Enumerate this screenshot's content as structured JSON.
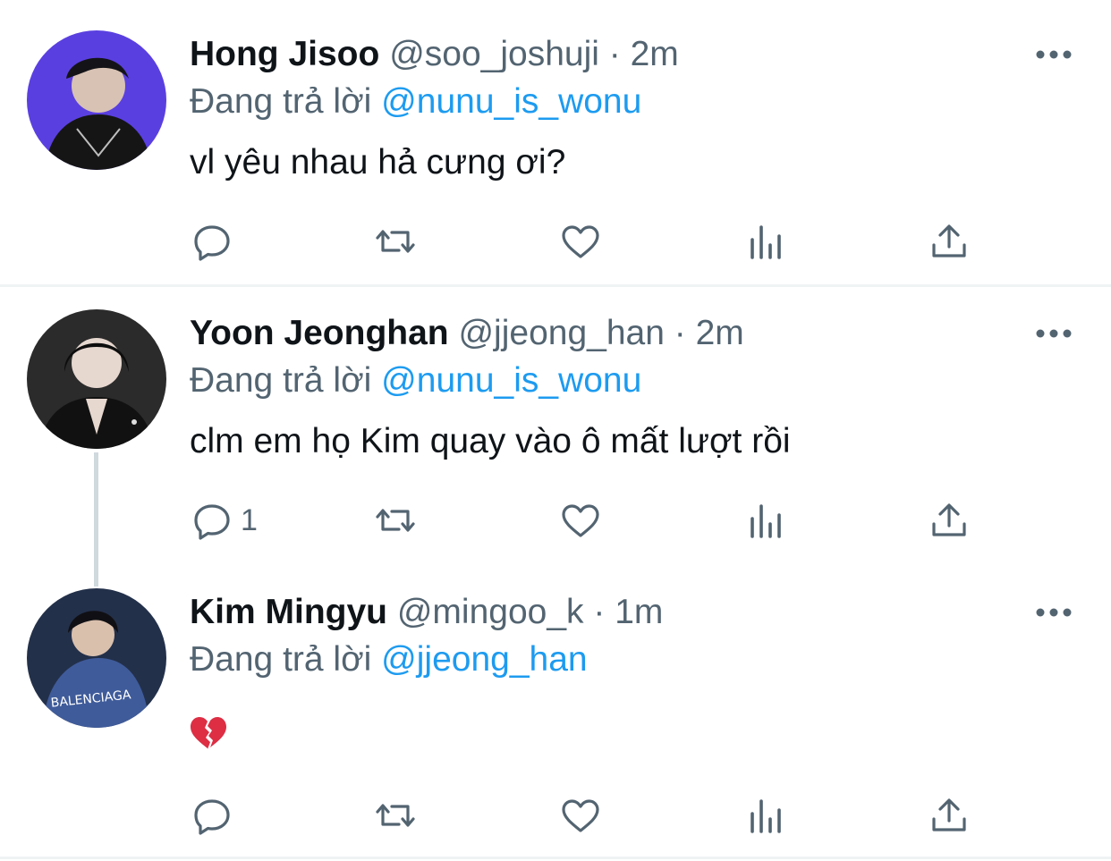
{
  "tweets": [
    {
      "name": "Hong Jisoo",
      "handle": "@soo_joshuji",
      "dot": "·",
      "time": "2m",
      "replying_prefix": "Đang trả lời",
      "replying_to": "@nunu_is_wonu",
      "text": "vl yêu nhau hả cưng ơi?",
      "reply_count": "",
      "avatar_bg": "#5a3fe0"
    },
    {
      "name": "Yoon Jeonghan",
      "handle": "@jjeong_han",
      "dot": "·",
      "time": "2m",
      "replying_prefix": "Đang trả lời",
      "replying_to": "@nunu_is_wonu",
      "text": "clm em họ Kim quay vào ô mất lượt rồi",
      "reply_count": "1",
      "avatar_bg": "#2b2b2b"
    },
    {
      "name": "Kim Mingyu",
      "handle": "@mingoo_k",
      "dot": "·",
      "time": "1m",
      "replying_prefix": "Đang trả lời",
      "replying_to": "@jjeong_han",
      "text": "💔",
      "reply_count": "",
      "avatar_bg": "#23304a"
    }
  ],
  "icons": {
    "reply": "reply-icon",
    "retweet": "retweet-icon",
    "like": "like-icon",
    "analytics": "analytics-icon",
    "share": "share-icon",
    "more": "more-icon",
    "broken_heart": "broken-heart-icon"
  },
  "colors": {
    "text": "#0f1419",
    "secondary": "#536471",
    "link": "#1d9bf0",
    "divider": "#eff3f4",
    "thread_line": "#cfd9de"
  }
}
